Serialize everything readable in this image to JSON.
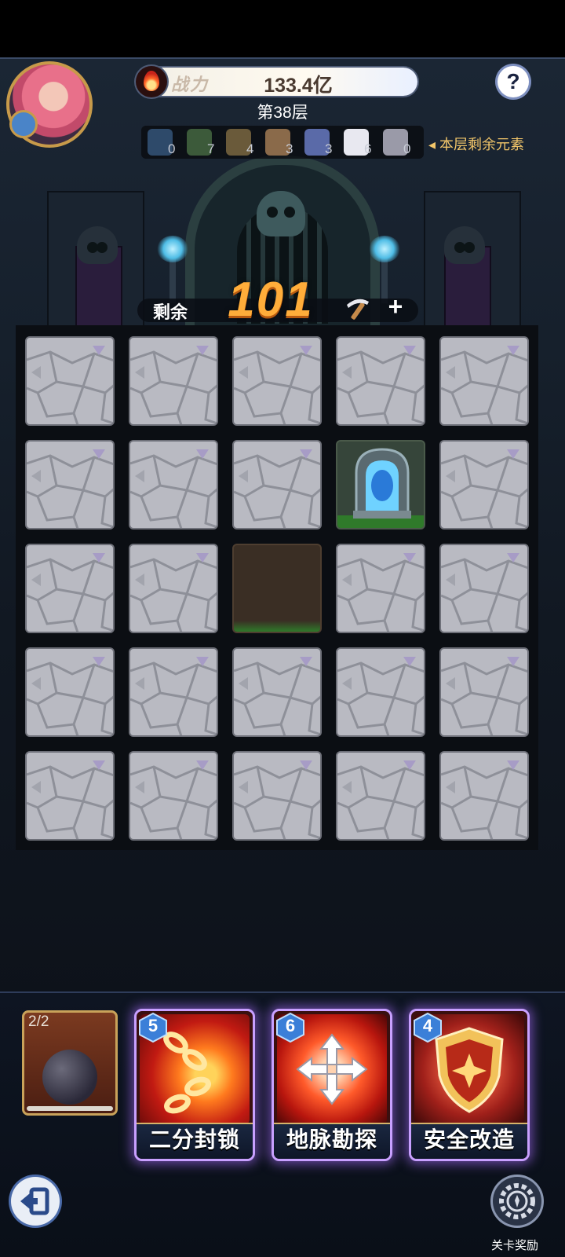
{
  "header": {
    "power_label": "战力",
    "power_value": "133.4亿",
    "floor": "第38层",
    "help_label": "?"
  },
  "elements": {
    "items": [
      {
        "icon": "portal-icon",
        "count": "0"
      },
      {
        "icon": "blocked-tile-icon",
        "count": "7"
      },
      {
        "icon": "treasure-chest-icon",
        "count": "4"
      },
      {
        "icon": "pickaxe-icon",
        "count": "3"
      },
      {
        "icon": "sword-crest-icon",
        "count": "3"
      },
      {
        "icon": "spiderweb-icon",
        "count": "6"
      },
      {
        "icon": "puzzle-piece-icon",
        "count": "0"
      }
    ],
    "hint": "◂ 本层剩余元素"
  },
  "counter": {
    "label": "剩余",
    "value": "101",
    "plus": "+"
  },
  "grid": {
    "rows": 5,
    "cols": 5,
    "special_tiles": [
      {
        "row": 2,
        "col": 4,
        "type": "portal"
      },
      {
        "row": 3,
        "col": 3,
        "type": "dug"
      }
    ]
  },
  "bottom": {
    "bomb": {
      "count": "2/2"
    },
    "skills": [
      {
        "cost": "5",
        "name": "二分封锁",
        "icon": "chain-icon"
      },
      {
        "cost": "6",
        "name": "地脉勘探",
        "icon": "cross-arrows-icon"
      },
      {
        "cost": "4",
        "name": "安全改造",
        "icon": "shield-icon"
      }
    ],
    "rewards_label": "关卡奖励"
  },
  "colors": {
    "accent_gold": "#f3c66a",
    "counter_orange": "#ffad3a",
    "skill_glow": "#c8a0ff"
  }
}
